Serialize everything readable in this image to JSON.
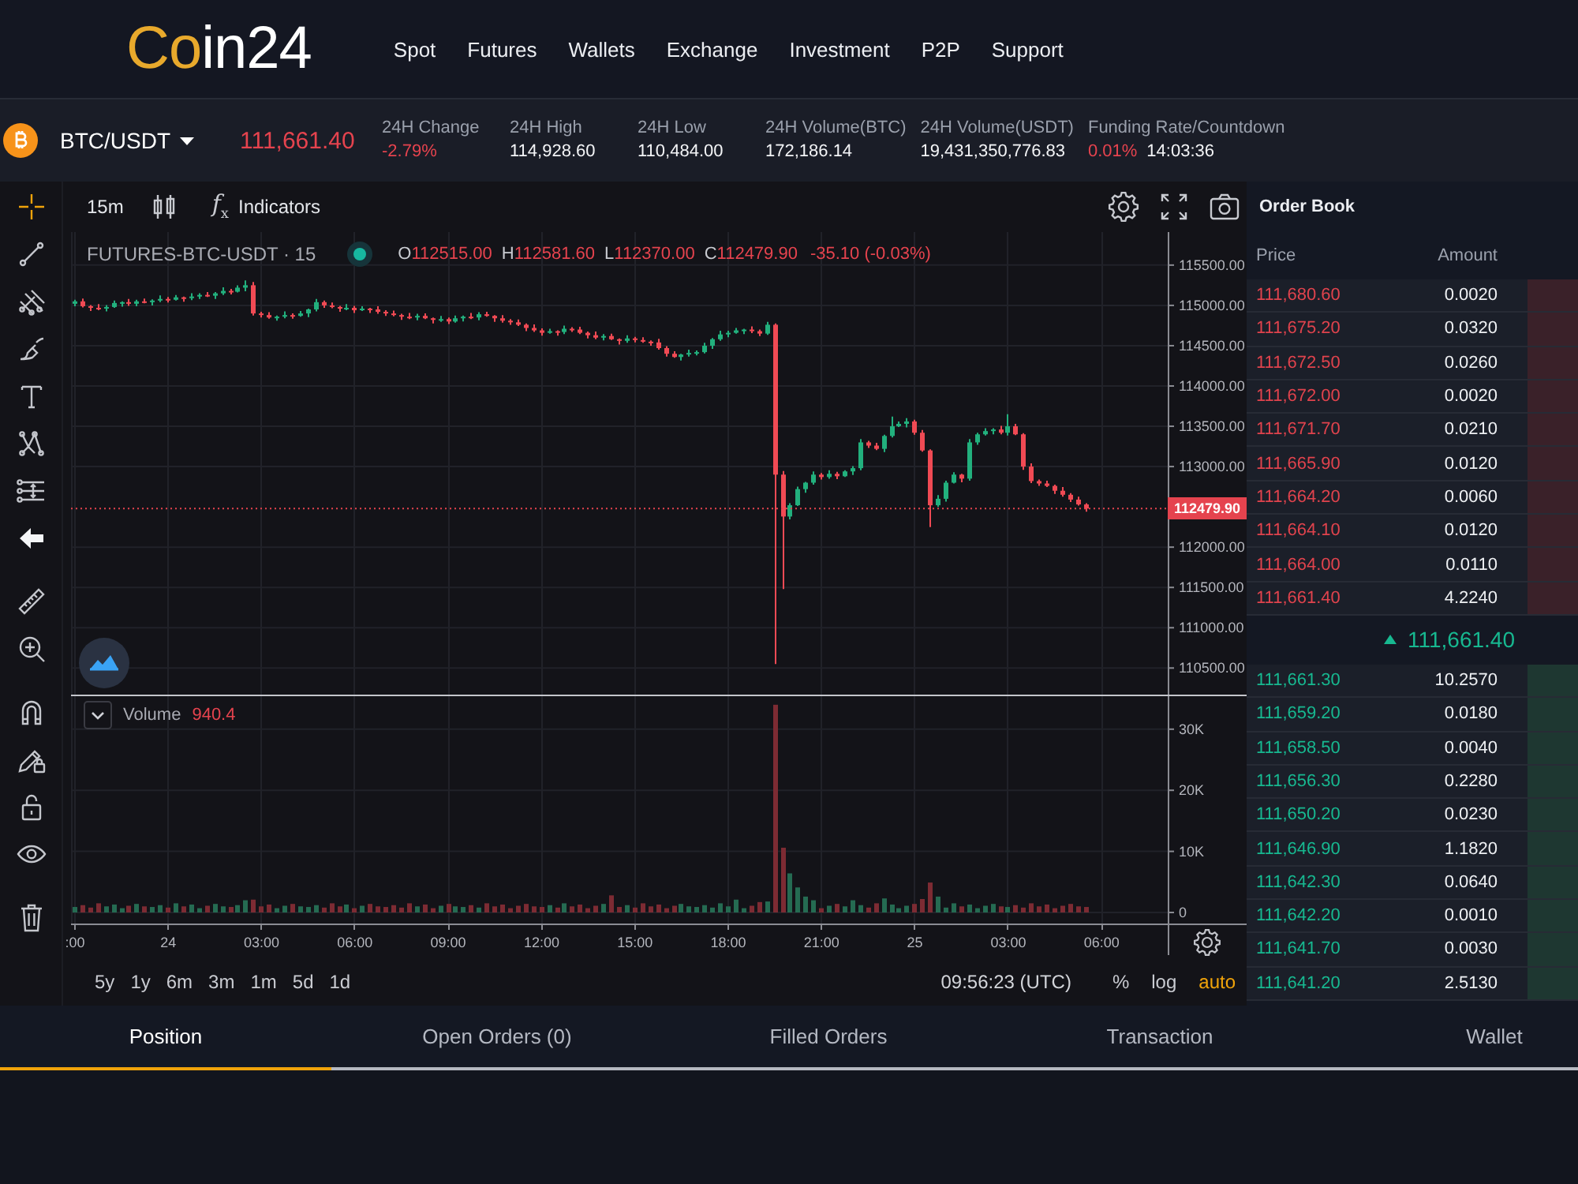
{
  "header": {
    "logo": {
      "accent": "Co",
      "rest": "in24"
    },
    "nav": [
      "Spot",
      "Futures",
      "Wallets",
      "Exchange",
      "Investment",
      "P2P",
      "Support"
    ]
  },
  "ticker": {
    "pair": "BTC/USDT",
    "last_price": {
      "text": "111,661.40",
      "color": "#e5434e"
    },
    "stats": [
      {
        "label": "24H Change",
        "values": [
          {
            "text": "-2.79%",
            "color": "#e5434e"
          }
        ]
      },
      {
        "label": "24H High",
        "values": [
          {
            "text": "114,928.60",
            "color": "#f3f4f6"
          }
        ]
      },
      {
        "label": "24H Low",
        "values": [
          {
            "text": "110,484.00",
            "color": "#f3f4f6"
          }
        ]
      },
      {
        "label": "24H Volume(BTC)",
        "values": [
          {
            "text": "172,186.14",
            "color": "#f3f4f6"
          }
        ]
      },
      {
        "label": "24H Volume(USDT)",
        "values": [
          {
            "text": "19,431,350,776.83",
            "color": "#f3f4f6"
          }
        ]
      },
      {
        "label": "Funding Rate/Countdown",
        "values": [
          {
            "text": "0.01%",
            "color": "#e5434e"
          },
          {
            "text": "14:03:36",
            "color": "#f3f4f6"
          }
        ]
      }
    ]
  },
  "chart": {
    "interval": "15m",
    "indicator_symbol": "*f*$_{x}$",
    "indicators": "Indicators",
    "tool_groups": [
      [
        {
          "kind": "crosshair",
          "selected": true
        },
        {
          "kind": "trend-line",
          "selected": false
        },
        {
          "kind": "pitchfork",
          "selected": false
        },
        {
          "kind": "brush",
          "selected": false
        },
        {
          "kind": "text",
          "selected": false
        },
        {
          "kind": "pattern",
          "selected": false
        },
        {
          "kind": "measure",
          "selected": false
        },
        {
          "kind": "arrow-left",
          "selected": false
        }
      ],
      [
        {
          "kind": "ruler",
          "selected": false
        },
        {
          "kind": "zoom-in",
          "selected": false
        }
      ],
      [
        {
          "kind": "magnet",
          "selected": false
        },
        {
          "kind": "lock-drawing",
          "selected": false
        },
        {
          "kind": "unlock",
          "selected": false
        },
        {
          "kind": "eye",
          "selected": false
        }
      ],
      [
        {
          "kind": "trash",
          "selected": false
        }
      ]
    ],
    "legend": {
      "symbol": "FUTURES-BTC-USDT · 15",
      "ohlc": [
        {
          "label": "O",
          "value": "112515.00"
        },
        {
          "label": "H",
          "value": "112581.60"
        },
        {
          "label": "L",
          "value": "112370.00"
        },
        {
          "label": "C",
          "value": "112479.90"
        }
      ],
      "change": "-35.10 (-0.03%)"
    },
    "price_pane": {
      "chart_data": {
        "type": "candlestick",
        "grid": true,
        "categories": [
          null,
          null,
          null,
          null,
          null,
          null,
          null,
          null,
          null,
          null,
          null,
          null,
          null,
          null,
          null,
          null,
          null,
          null,
          null,
          null,
          null,
          null,
          null,
          null,
          null,
          null,
          null,
          null,
          null,
          null,
          null,
          null,
          null,
          null,
          null,
          null,
          null,
          null,
          null,
          null,
          null,
          null,
          null,
          null,
          null,
          null,
          null,
          null,
          null,
          null,
          null,
          null,
          null,
          null,
          null,
          null,
          null,
          null,
          null,
          null,
          null,
          null,
          null,
          null,
          null,
          null,
          null,
          null,
          null,
          null,
          null,
          null,
          null,
          null,
          null,
          null,
          null,
          null,
          null,
          null,
          null,
          null,
          null,
          null,
          null,
          null,
          null,
          null,
          null,
          null,
          null,
          null,
          null,
          null,
          null,
          null,
          null,
          null,
          null,
          null,
          null,
          null,
          null,
          null,
          null,
          null,
          null,
          null,
          null,
          null,
          null,
          null,
          null,
          null,
          null,
          null,
          null,
          null,
          null,
          null,
          null,
          null,
          null,
          null,
          null,
          null,
          null,
          null,
          null,
          null,
          null,
          null,
          null,
          null,
          null,
          null,
          null,
          null,
          null,
          null,
          null
        ],
        "ohlc": [
          [
            115020,
            115070,
            114990,
            115050
          ],
          [
            115050,
            115085,
            114975,
            114990
          ],
          [
            114990,
            115005,
            114930,
            114970
          ],
          [
            114970,
            115015,
            114940,
            114960
          ],
          [
            114960,
            115005,
            114925,
            114980
          ],
          [
            114980,
            115060,
            114970,
            115030
          ],
          [
            115030,
            115050,
            114985,
            115040
          ],
          [
            115040,
            115080,
            114995,
            115020
          ],
          [
            115020,
            115070,
            114990,
            115050
          ],
          [
            115050,
            115085,
            115025,
            115040
          ],
          [
            115040,
            115075,
            115000,
            115060
          ],
          [
            115060,
            115125,
            115040,
            115080
          ],
          [
            115080,
            115105,
            115035,
            115070
          ],
          [
            115070,
            115130,
            115060,
            115100
          ],
          [
            115100,
            115110,
            115045,
            115090
          ],
          [
            115090,
            115150,
            115065,
            115110
          ],
          [
            115110,
            115150,
            115080,
            115130
          ],
          [
            115130,
            115165,
            115105,
            115120
          ],
          [
            115120,
            115165,
            115080,
            115150
          ],
          [
            115150,
            115225,
            115130,
            115180
          ],
          [
            115180,
            115205,
            115135,
            115170
          ],
          [
            115170,
            115250,
            115160,
            115220
          ],
          [
            115220,
            115310,
            115175,
            115250
          ],
          [
            115250,
            115290,
            114875,
            114900
          ],
          [
            114900,
            114920,
            114850,
            114880
          ],
          [
            114880,
            114915,
            114835,
            114850
          ],
          [
            114850,
            114875,
            114810,
            114860
          ],
          [
            114860,
            114925,
            114840,
            114880
          ],
          [
            114880,
            114900,
            114835,
            114870
          ],
          [
            114870,
            114930,
            114860,
            114900
          ],
          [
            114900,
            114960,
            114855,
            114950
          ],
          [
            114950,
            115080,
            114925,
            115040
          ],
          [
            115040,
            115060,
            114970,
            115000
          ],
          [
            115000,
            115035,
            114965,
            114980
          ],
          [
            114980,
            114995,
            114920,
            114960
          ],
          [
            114960,
            115015,
            114940,
            114970
          ],
          [
            114970,
            114995,
            114905,
            114940
          ],
          [
            114940,
            114990,
            114930,
            114960
          ],
          [
            114960,
            114970,
            114905,
            114950
          ],
          [
            114950,
            114990,
            114895,
            114920
          ],
          [
            114920,
            114940,
            114870,
            114900
          ],
          [
            114900,
            114935,
            114865,
            114880
          ],
          [
            114880,
            114895,
            114820,
            114860
          ],
          [
            114860,
            114905,
            114830,
            114850
          ],
          [
            114850,
            114895,
            114815,
            114870
          ],
          [
            114870,
            114900,
            114830,
            114840
          ],
          [
            114840,
            114850,
            114775,
            114820
          ],
          [
            114820,
            114870,
            114795,
            114830
          ],
          [
            114830,
            114850,
            114770,
            114800
          ],
          [
            114800,
            114875,
            114785,
            114840
          ],
          [
            114840,
            114875,
            114800,
            114860
          ],
          [
            114860,
            114905,
            114830,
            114850
          ],
          [
            114850,
            114915,
            114815,
            114890
          ],
          [
            114890,
            114920,
            114860,
            114870
          ],
          [
            114870,
            114880,
            114795,
            114840
          ],
          [
            114840,
            114880,
            114785,
            114810
          ],
          [
            114810,
            114830,
            114760,
            114790
          ],
          [
            114790,
            114825,
            114745,
            114760
          ],
          [
            114760,
            114775,
            114680,
            114720
          ],
          [
            114720,
            114765,
            114670,
            114690
          ],
          [
            114690,
            114715,
            114625,
            114660
          ],
          [
            114660,
            114710,
            114650,
            114680
          ],
          [
            114680,
            114690,
            114625,
            114670
          ],
          [
            114670,
            114750,
            114645,
            114710
          ],
          [
            114710,
            114730,
            114670,
            114700
          ],
          [
            114700,
            114735,
            114645,
            114660
          ],
          [
            114660,
            114675,
            114590,
            114630
          ],
          [
            114630,
            114675,
            114580,
            114600
          ],
          [
            114600,
            114645,
            114565,
            114620
          ],
          [
            114620,
            114650,
            114570,
            114580
          ],
          [
            114580,
            114590,
            114515,
            114560
          ],
          [
            114560,
            114630,
            114535,
            114590
          ],
          [
            114590,
            114610,
            114540,
            114570
          ],
          [
            114570,
            114605,
            114535,
            114550
          ],
          [
            114550,
            114565,
            114500,
            114540
          ],
          [
            114540,
            114585,
            114450,
            114470
          ],
          [
            114470,
            114495,
            114365,
            114400
          ],
          [
            114400,
            114430,
            114350,
            114360
          ],
          [
            114360,
            114400,
            114315,
            114390
          ],
          [
            114390,
            114450,
            114365,
            114410
          ],
          [
            114410,
            114440,
            114380,
            114420
          ],
          [
            114420,
            114535,
            114405,
            114500
          ],
          [
            114500,
            114595,
            114460,
            114580
          ],
          [
            114580,
            114685,
            114560,
            114640
          ],
          [
            114640,
            114685,
            114605,
            114660
          ],
          [
            114660,
            114720,
            114650,
            114690
          ],
          [
            114690,
            114710,
            114645,
            114700
          ],
          [
            114700,
            114740,
            114655,
            114680
          ],
          [
            114680,
            114700,
            114620,
            114650
          ],
          [
            114650,
            114795,
            114635,
            114760
          ],
          [
            114760,
            114775,
            110550,
            112900
          ],
          [
            112900,
            112945,
            111480,
            112380
          ],
          [
            112380,
            112545,
            112345,
            112520
          ],
          [
            112520,
            112750,
            112510,
            112720
          ],
          [
            112720,
            112810,
            112675,
            112800
          ],
          [
            112800,
            112940,
            112775,
            112900
          ],
          [
            112900,
            112920,
            112840,
            112870
          ],
          [
            112870,
            112955,
            112850,
            112910
          ],
          [
            112910,
            112935,
            112845,
            112880
          ],
          [
            112880,
            112955,
            112870,
            112940
          ],
          [
            112940,
            113005,
            112895,
            112980
          ],
          [
            112980,
            113340,
            112955,
            113300
          ],
          [
            113300,
            113320,
            113230,
            113260
          ],
          [
            113260,
            113295,
            113205,
            113220
          ],
          [
            113220,
            113395,
            113180,
            113380
          ],
          [
            113380,
            113620,
            113360,
            113500
          ],
          [
            113500,
            113560,
            113490,
            113530
          ],
          [
            113530,
            113600,
            113485,
            113560
          ],
          [
            113560,
            113580,
            113395,
            113420
          ],
          [
            113420,
            113455,
            113185,
            113200
          ],
          [
            113200,
            113215,
            112250,
            112520
          ],
          [
            112520,
            112645,
            112500,
            112600
          ],
          [
            112600,
            112825,
            112565,
            112800
          ],
          [
            112800,
            112930,
            112790,
            112900
          ],
          [
            112900,
            112910,
            112805,
            112850
          ],
          [
            112850,
            113340,
            112825,
            113300
          ],
          [
            113300,
            113420,
            113270,
            113400
          ],
          [
            113400,
            113475,
            113385,
            113440
          ],
          [
            113440,
            113475,
            113400,
            113460
          ],
          [
            113460,
            113505,
            113400,
            113420
          ],
          [
            113420,
            113650,
            113385,
            113500
          ],
          [
            113500,
            113530,
            113390,
            113400
          ],
          [
            113400,
            113415,
            112960,
            113000
          ],
          [
            113000,
            113040,
            112795,
            112820
          ],
          [
            112820,
            112840,
            112760,
            112790
          ],
          [
            112790,
            112825,
            112745,
            112760
          ],
          [
            112760,
            112775,
            112660,
            112700
          ],
          [
            112700,
            112745,
            112625,
            112650
          ],
          [
            112650,
            112670,
            112560,
            112590
          ],
          [
            112590,
            112625,
            112515,
            112530
          ],
          [
            112530,
            112545,
            112440,
            112479.9
          ],
          null,
          null,
          null,
          null,
          null,
          null,
          null,
          null,
          null,
          null
        ],
        "ylim": [
          110170,
          115910
        ],
        "yticks": [
          {
            "value": 115500,
            "label": "115500.00"
          },
          {
            "value": 115000,
            "label": "115000.00"
          },
          {
            "value": 114500,
            "label": "114500.00"
          },
          {
            "value": 114000,
            "label": "114000.00"
          },
          {
            "value": 113500,
            "label": "113500.00"
          },
          {
            "value": 113000,
            "label": "113000.00"
          },
          {
            "value": 112000,
            "label": "112000.00"
          },
          {
            "value": 111500,
            "label": "111500.00"
          },
          {
            "value": 111000,
            "label": "111000.00"
          },
          {
            "value": 110500,
            "label": "110500.00"
          }
        ],
        "ref_lines": [
          {
            "axis": "y",
            "value": 112479.9,
            "label": "112479.90",
            "color": "#e5434e"
          }
        ]
      }
    },
    "volume_pane": {
      "legend": {
        "label": "Volume",
        "value": "940.4"
      },
      "chart_data": {
        "type": "bar",
        "grid": true,
        "categories": [
          ":00",
          null,
          null,
          null,
          null,
          null,
          null,
          null,
          null,
          null,
          null,
          null,
          "24",
          null,
          null,
          null,
          null,
          null,
          null,
          null,
          null,
          null,
          null,
          null,
          "03:00",
          null,
          null,
          null,
          null,
          null,
          null,
          null,
          null,
          null,
          null,
          null,
          "06:00",
          null,
          null,
          null,
          null,
          null,
          null,
          null,
          null,
          null,
          null,
          null,
          "09:00",
          null,
          null,
          null,
          null,
          null,
          null,
          null,
          null,
          null,
          null,
          null,
          "12:00",
          null,
          null,
          null,
          null,
          null,
          null,
          null,
          null,
          null,
          null,
          null,
          "15:00",
          null,
          null,
          null,
          null,
          null,
          null,
          null,
          null,
          null,
          null,
          null,
          "18:00",
          null,
          null,
          null,
          null,
          null,
          null,
          null,
          null,
          null,
          null,
          null,
          "21:00",
          null,
          null,
          null,
          null,
          null,
          null,
          null,
          null,
          null,
          null,
          null,
          "25",
          null,
          null,
          null,
          null,
          null,
          null,
          null,
          null,
          null,
          null,
          null,
          "03:00",
          null,
          null,
          null,
          null,
          null,
          null,
          null,
          null,
          null,
          null,
          null,
          "06:00",
          null,
          null,
          null,
          null,
          null,
          null,
          null,
          null
        ],
        "values": [
          900,
          1200,
          800,
          1500,
          1000,
          1300,
          700,
          1100,
          1400,
          1000,
          900,
          1200,
          800,
          1500,
          1000,
          1300,
          700,
          1100,
          1400,
          1000,
          900,
          1200,
          2000,
          2100,
          1000,
          1300,
          700,
          1100,
          1400,
          1000,
          900,
          1200,
          800,
          1500,
          1000,
          1300,
          700,
          1100,
          1400,
          1000,
          900,
          1200,
          800,
          1500,
          1000,
          1300,
          700,
          1100,
          1400,
          1000,
          900,
          1200,
          800,
          1500,
          1000,
          1300,
          700,
          1100,
          1400,
          1000,
          900,
          1200,
          800,
          1500,
          1000,
          1300,
          700,
          1100,
          1400,
          2800,
          900,
          1200,
          800,
          1500,
          1000,
          1300,
          700,
          1100,
          1400,
          1000,
          900,
          1200,
          800,
          1500,
          1000,
          2100,
          700,
          1100,
          1700,
          1800,
          34000,
          10600,
          6400,
          4100,
          2600,
          2000,
          700,
          1100,
          1400,
          1000,
          2000,
          1200,
          800,
          1500,
          2300,
          1300,
          700,
          1100,
          1400,
          2200,
          4900,
          2600,
          800,
          1500,
          1000,
          1300,
          700,
          1100,
          1400,
          1000,
          900,
          1200,
          800,
          1500,
          1000,
          1300,
          700,
          1100,
          1400,
          1000,
          900,
          null,
          null,
          null,
          null,
          null,
          null,
          null,
          null,
          null,
          null
        ],
        "ylim": [
          0,
          35660
        ],
        "yticks": [
          {
            "value": 30000,
            "label": "30K"
          },
          {
            "value": 20000,
            "label": "20K"
          },
          {
            "value": 10000,
            "label": "10K"
          },
          {
            "value": 0,
            "label": "0"
          }
        ]
      }
    },
    "ranges": [
      "5y",
      "1y",
      "6m",
      "3m",
      "1m",
      "5d",
      "1d"
    ],
    "clock": "09:56:23 (UTC)",
    "scale_options": [
      {
        "label": "%",
        "selected": false
      },
      {
        "label": "log",
        "selected": false
      },
      {
        "label": "auto",
        "selected": true
      }
    ]
  },
  "order_book": {
    "title": "Order Book",
    "columns": [
      "Price",
      "Amount"
    ],
    "asks": [
      {
        "price": "111,680.60",
        "amount": "0.0020"
      },
      {
        "price": "111,675.20",
        "amount": "0.0320"
      },
      {
        "price": "111,672.50",
        "amount": "0.0260"
      },
      {
        "price": "111,672.00",
        "amount": "0.0020"
      },
      {
        "price": "111,671.70",
        "amount": "0.0210"
      },
      {
        "price": "111,665.90",
        "amount": "0.0120"
      },
      {
        "price": "111,664.20",
        "amount": "0.0060"
      },
      {
        "price": "111,664.10",
        "amount": "0.0120"
      },
      {
        "price": "111,664.00",
        "amount": "0.0110"
      },
      {
        "price": "111,661.40",
        "amount": "4.2240"
      }
    ],
    "mid": {
      "price": "111,661.40",
      "rising": true
    },
    "bids": [
      {
        "price": "111,661.30",
        "amount": "10.2570"
      },
      {
        "price": "111,659.20",
        "amount": "0.0180"
      },
      {
        "price": "111,658.50",
        "amount": "0.0040"
      },
      {
        "price": "111,656.30",
        "amount": "0.2280"
      },
      {
        "price": "111,650.20",
        "amount": "0.0230"
      },
      {
        "price": "111,646.90",
        "amount": "1.1820"
      },
      {
        "price": "111,642.30",
        "amount": "0.0640"
      },
      {
        "price": "111,642.20",
        "amount": "0.0010"
      },
      {
        "price": "111,641.70",
        "amount": "0.0030"
      },
      {
        "price": "111,641.20",
        "amount": "2.5130"
      }
    ]
  },
  "bottom_tabs": [
    {
      "label": "Position",
      "selected": true
    },
    {
      "label": "Open Orders (0)",
      "selected": false
    },
    {
      "label": "Filled Orders",
      "selected": false
    },
    {
      "label": "Transaction",
      "selected": false
    },
    {
      "label": "Wallet",
      "selected": false
    }
  ]
}
